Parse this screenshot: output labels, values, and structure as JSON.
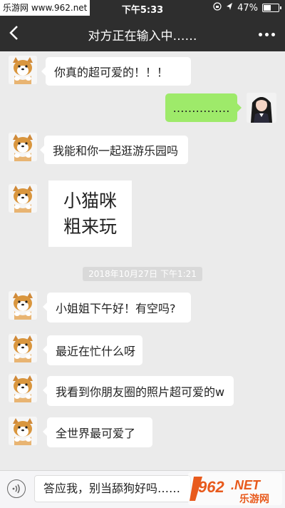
{
  "status_bar": {
    "time": "下午5:33",
    "battery": "47%",
    "watermark": "乐游网 www.962.net"
  },
  "nav": {
    "title": "对方正在输入中……",
    "back_icon": "chevron-left-icon",
    "more_icon": "more-dots-icon"
  },
  "messages": [
    {
      "side": "left",
      "text": "你真的超可爱的！！！"
    },
    {
      "side": "right",
      "text": "……………"
    },
    {
      "side": "left",
      "text": "我能和你一起逛游乐园吗"
    },
    {
      "side": "left",
      "sticker": [
        "小猫咪",
        "粗来玩"
      ]
    },
    {
      "side": "left",
      "text": "小姐姐下午好！有空吗?"
    },
    {
      "side": "left",
      "text": "最近在忙什么呀"
    },
    {
      "side": "left",
      "text": "我看到你朋友圈的照片超可爱的w"
    },
    {
      "side": "left",
      "text": "全世界最可爱了"
    }
  ],
  "timestamp": "2018年10月27日 下午1:21",
  "input_bar": {
    "text": "答应我，别当舔狗好吗……",
    "voice_icon": "voice-icon"
  },
  "watermark_br": {
    "number": "962",
    "suffix": ".NET",
    "label": "乐游网"
  },
  "colors": {
    "nav_bg": "#2e2e2e",
    "chat_bg": "#ebebeb",
    "sent_bubble": "#9eea6a",
    "received_bubble": "#ffffff"
  }
}
